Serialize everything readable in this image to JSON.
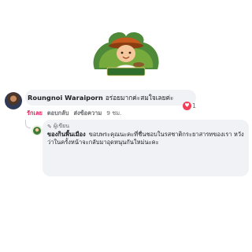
{
  "page": {
    "logo_name": "page-logo",
    "logo_banner_text": "สั่งรถสตางค์"
  },
  "comment": {
    "author": "Roungnoi Waraiporn",
    "text": "อร่อยมากค่ะสมใจเลยค่ะ",
    "reaction_count": "1",
    "actions": {
      "like": "รักเลย",
      "reply": "ตอบกลับ",
      "share": "ส่งข้อความ",
      "time": "9 ชม."
    }
  },
  "reply": {
    "label": "ผู้เขียน",
    "author": "ของกินพื้นเมือง",
    "text": "ขอบพระคุณนะคะที่ชื่นชอบในรสชาติกระยาสารทของเรา หวังว่าในครั้งหน้าจะกลับมาอุดหนุนกันใหม่นะคะ"
  },
  "colors": {
    "bubble": "#f0f2f5",
    "like_active": "#e0245e",
    "heart": "#f33e58",
    "logo_orange": "#f08a1c",
    "logo_green": "#3f7a36"
  }
}
